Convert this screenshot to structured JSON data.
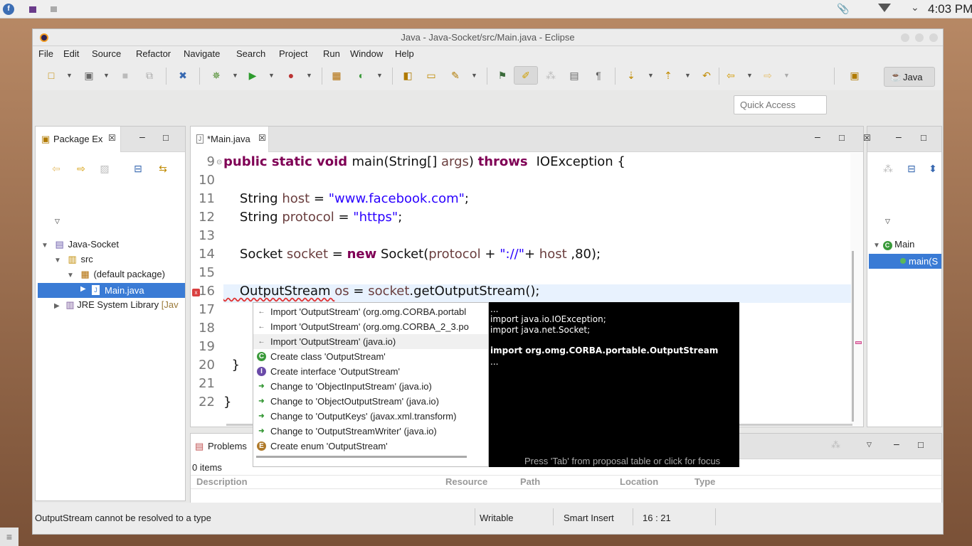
{
  "system": {
    "clock": "4:03 PM"
  },
  "window": {
    "title": "Java - Java-Socket/src/Main.java - Eclipse"
  },
  "menu": [
    "File",
    "Edit",
    "Source",
    "Refactor",
    "Navigate",
    "Search",
    "Project",
    "Run",
    "Window",
    "Help"
  ],
  "toolbar": {
    "quick_access_placeholder": "Quick Access",
    "perspective": "Java"
  },
  "package_explorer": {
    "tab": "Package Ex",
    "tree": {
      "project": "Java-Socket",
      "src": "src",
      "package": "(default package)",
      "file": "Main.java",
      "jre": "JRE System Library",
      "jre_suffix": "[Jav"
    }
  },
  "editor": {
    "tab": "*Main.java",
    "lines": [
      {
        "n": "9",
        "parts": [
          [
            "kw",
            "public static void "
          ],
          [
            "t",
            "main(String[] "
          ],
          [
            "var",
            "args"
          ],
          [
            "t",
            ") "
          ],
          [
            "kw",
            "throws "
          ],
          [
            "t",
            " IOException {"
          ]
        ]
      },
      {
        "n": "10",
        "parts": []
      },
      {
        "n": "11",
        "parts": [
          [
            "t",
            "    String "
          ],
          [
            "var",
            "host"
          ],
          [
            "t",
            " = "
          ],
          [
            "str",
            "\"www.facebook.com\""
          ],
          [
            "t",
            ";"
          ]
        ]
      },
      {
        "n": "12",
        "parts": [
          [
            "t",
            "    String "
          ],
          [
            "var",
            "protocol"
          ],
          [
            "t",
            " = "
          ],
          [
            "str",
            "\"https\""
          ],
          [
            "t",
            ";"
          ]
        ]
      },
      {
        "n": "13",
        "parts": []
      },
      {
        "n": "14",
        "parts": [
          [
            "t",
            "    Socket "
          ],
          [
            "var",
            "socket"
          ],
          [
            "t",
            " = "
          ],
          [
            "kw",
            "new"
          ],
          [
            "t",
            " Socket("
          ],
          [
            "var",
            "protocol"
          ],
          [
            "t",
            " + "
          ],
          [
            "str",
            "\"://\""
          ],
          [
            "t",
            "+ "
          ],
          [
            "var",
            "host"
          ],
          [
            "t",
            " ,80);"
          ]
        ]
      },
      {
        "n": "15",
        "parts": []
      },
      {
        "n": "16",
        "parts": [
          [
            "t",
            "    OutputStream "
          ],
          [
            "var",
            "os"
          ],
          [
            "t",
            " = "
          ],
          [
            "var",
            "socket"
          ],
          [
            "t",
            ".getOutputStream();"
          ]
        ]
      },
      {
        "n": "17",
        "parts": []
      },
      {
        "n": "18",
        "parts": []
      },
      {
        "n": "19",
        "parts": []
      },
      {
        "n": "20",
        "parts": [
          [
            "t",
            "  }"
          ]
        ]
      },
      {
        "n": "21",
        "parts": []
      },
      {
        "n": "22",
        "parts": [
          [
            "t",
            "}"
          ]
        ]
      }
    ]
  },
  "proposals": [
    {
      "icon": "import",
      "label": "Import 'OutputStream' (org.omg.CORBA.portabl"
    },
    {
      "icon": "import",
      "label": "Import 'OutputStream' (org.omg.CORBA_2_3.po"
    },
    {
      "icon": "import",
      "label": "Import 'OutputStream' (java.io)"
    },
    {
      "icon": "class",
      "label": "Create class 'OutputStream'"
    },
    {
      "icon": "interface",
      "label": "Create interface 'OutputStream'"
    },
    {
      "icon": "change",
      "label": "Change to 'ObjectInputStream' (java.io)"
    },
    {
      "icon": "change",
      "label": "Change to 'ObjectOutputStream' (java.io)"
    },
    {
      "icon": "change",
      "label": "Change to 'OutputKeys' (javax.xml.transform)"
    },
    {
      "icon": "change",
      "label": "Change to 'OutputStreamWriter' (java.io)"
    },
    {
      "icon": "enum",
      "label": "Create enum 'OutputStream'"
    }
  ],
  "preview": {
    "l1": "...",
    "l2": "import java.io.IOException;",
    "l3": "import java.net.Socket;",
    "l4": "import org.omg.CORBA.portable.OutputStream",
    "l5": "...",
    "footer": "Press 'Tab' from proposal table or click for focus"
  },
  "outline": {
    "class": "Main",
    "method": "main(S"
  },
  "problems": {
    "tab": "Problems",
    "count": "0 items",
    "columns": [
      "Description",
      "Resource",
      "Path",
      "Location",
      "Type"
    ]
  },
  "statusbar": {
    "message": "OutputStream cannot be resolved to a type",
    "writable": "Writable",
    "insert": "Smart Insert",
    "position": "16 : 21"
  },
  "colors": {
    "selection": "#3a7bd5",
    "keyword": "#7f0055",
    "string": "#2a00ff"
  }
}
